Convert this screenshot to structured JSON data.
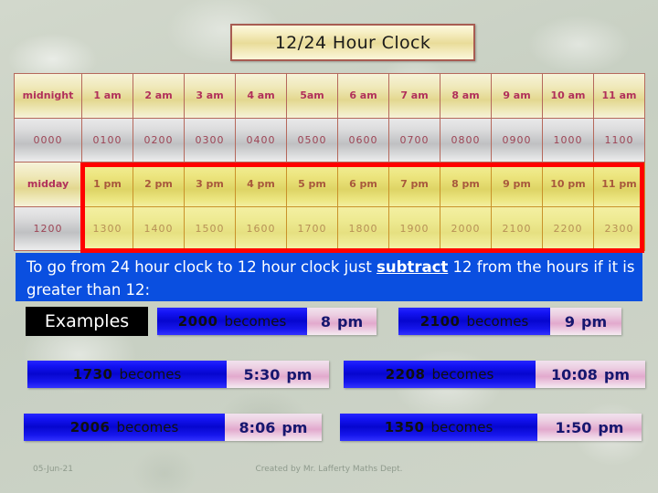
{
  "title": "12/24 Hour Clock",
  "table": {
    "rows": [
      {
        "name": "am-labels",
        "style": "cream",
        "cells": [
          "midnight",
          "1 am",
          "2 am",
          "3 am",
          "4 am",
          "5am",
          "6 am",
          "7 am",
          "8 am",
          "9 am",
          "10 am",
          "11 am"
        ]
      },
      {
        "name": "am-24hour",
        "style": "silver",
        "cells": [
          "0000",
          "0100",
          "0200",
          "0300",
          "0400",
          "0500",
          "0600",
          "0700",
          "0800",
          "0900",
          "1000",
          "1100"
        ]
      },
      {
        "name": "pm-labels",
        "style": "cream-then-yellow",
        "cells": [
          "midday",
          "1 pm",
          "2 pm",
          "3 pm",
          "4 pm",
          "5 pm",
          "6 pm",
          "7 pm",
          "8 pm",
          "9 pm",
          "10 pm",
          "11 pm"
        ]
      },
      {
        "name": "pm-24hour",
        "style": "silver-then-yellow",
        "cells": [
          "1200",
          "1300",
          "1400",
          "1500",
          "1600",
          "1700",
          "1800",
          "1900",
          "2000",
          "2100",
          "2200",
          "2300"
        ]
      }
    ],
    "highlight_color": "#ff0000",
    "border_color": "#b5685c"
  },
  "instruction": {
    "part1": "To go from 24 hour clock to 12 hour clock just ",
    "emphasis": "subtract",
    "part2": " 12 from the hours if it is greater than 12:"
  },
  "examples": {
    "label": "Examples",
    "verb": "becomes",
    "items": [
      {
        "from": "2000",
        "to_time": "8",
        "to_suffix": "pm"
      },
      {
        "from": "2100",
        "to_time": "9",
        "to_suffix": "pm"
      },
      {
        "from": "1730",
        "to_time": "5:30",
        "to_suffix": "pm"
      },
      {
        "from": "2208",
        "to_time": "10:08",
        "to_suffix": "pm"
      },
      {
        "from": "2006",
        "to_time": "8:06",
        "to_suffix": "pm"
      },
      {
        "from": "1350",
        "to_time": "1:50",
        "to_suffix": "pm"
      }
    ]
  },
  "footer": {
    "date": "05-Jun-21",
    "credit": "Created by Mr. Lafferty Maths Dept."
  },
  "colors": {
    "banner_blue": "#0a4fe0",
    "highlight_red": "#ff0000",
    "table_border": "#b5685c",
    "am_text": "#b1305a",
    "pm_text": "#a8593c"
  }
}
